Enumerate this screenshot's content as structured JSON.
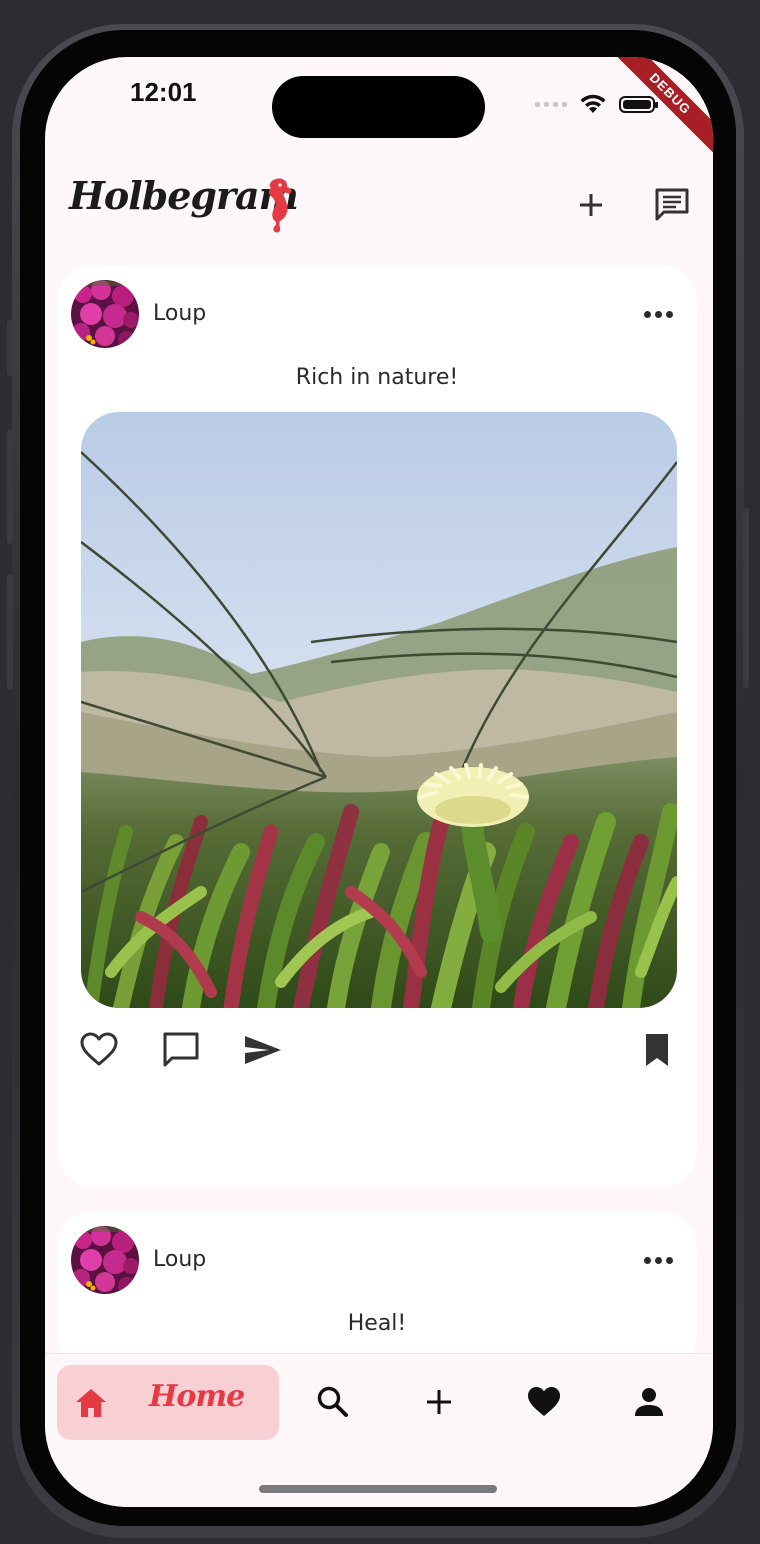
{
  "status_bar": {
    "time": "12:01",
    "debug_label": "DEBUG"
  },
  "app_bar": {
    "logo": "Holbegram",
    "add_icon": "plus-icon",
    "messages_icon": "message-icon"
  },
  "posts": [
    {
      "username": "Loup",
      "caption": "Rich in nature!",
      "image_description": "succulent-flower-photo"
    },
    {
      "username": "Loup",
      "caption": "Heal!"
    }
  ],
  "bottom_nav": {
    "items": [
      {
        "label": "Home",
        "icon": "home-icon",
        "active": true
      },
      {
        "label": "",
        "icon": "search-icon"
      },
      {
        "label": "",
        "icon": "plus-icon"
      },
      {
        "label": "",
        "icon": "heart-icon"
      },
      {
        "label": "",
        "icon": "person-icon"
      }
    ]
  },
  "colors": {
    "accent": "#e53944",
    "active_nav_bg": "#f8d0d3",
    "screen_bg": "#fdf7fa",
    "debug": "#a81e25"
  }
}
